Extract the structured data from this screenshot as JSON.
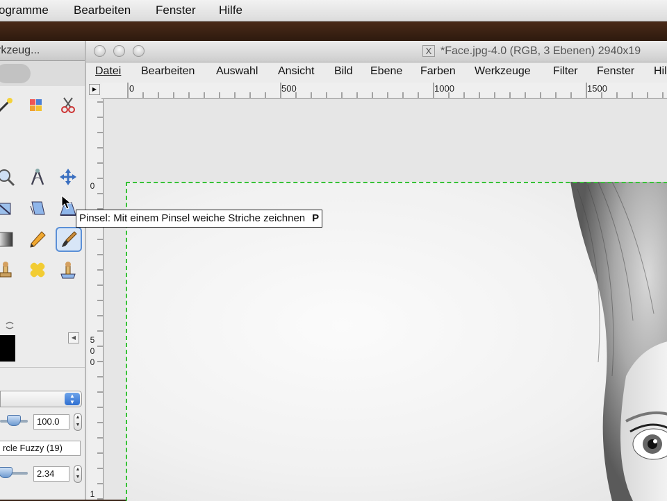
{
  "mac_menu": {
    "items": [
      "ogramme",
      "Bearbeiten",
      "Fenster",
      "Hilfe"
    ]
  },
  "toolbox": {
    "title": "rkzeug...",
    "opacity_value": "100.0",
    "brush_value": "rcle Fuzzy (19)",
    "scale_value": "2.34",
    "tools": [
      "fuzzy-select-icon",
      "select-by-color-icon",
      "scissors-icon",
      "zoom-icon",
      "measure-icon",
      "move-icon",
      "scale-icon",
      "shear-icon",
      "perspective-icon",
      "blend-icon",
      "pencil-icon",
      "paintbrush-icon",
      "clone-icon",
      "heal-icon",
      "perspective-clone-icon"
    ]
  },
  "image_window": {
    "title": "*Face.jpg-4.0 (RGB, 3 Ebenen) 2940x19",
    "x_badge": "X",
    "menu": [
      "Datei",
      "Bearbeiten",
      "Auswahl",
      "Ansicht",
      "Bild",
      "Ebene",
      "Farben",
      "Werkzeuge",
      "Filter",
      "Fenster",
      "Hil"
    ],
    "hruler_labels": [
      "0",
      "500",
      "1000",
      "1500"
    ],
    "vruler_labels": [
      "0",
      "5",
      "0",
      "0",
      "1"
    ]
  },
  "tooltip": {
    "text": "Pinsel: Mit einem Pinsel weiche Striche zeichnen",
    "shortcut": "P"
  }
}
